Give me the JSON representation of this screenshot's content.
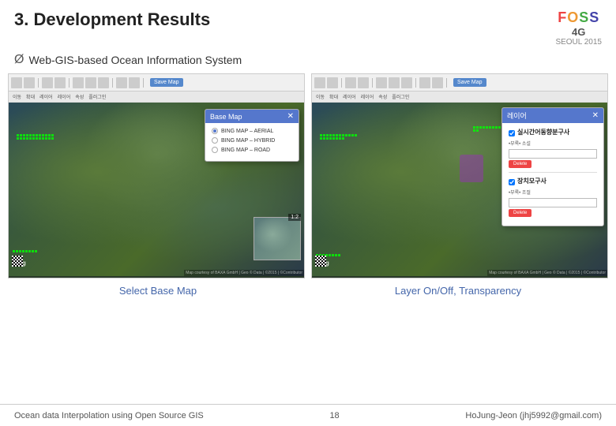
{
  "header": {
    "title": "3. Development Results",
    "logo": {
      "foss": "FOSS",
      "four_g": "4G",
      "seoul": "SEOUL 2015"
    }
  },
  "subtitle": {
    "prefix": "Ø",
    "text": "Web-GIS-based Ocean Information System"
  },
  "left_panel": {
    "toolbar": {
      "save_map": "Save Map"
    },
    "dialog": {
      "title": "Base Map",
      "options": [
        {
          "label": "BING MAP - AERIAL",
          "selected": true
        },
        {
          "label": "BING MAP - HYBRID",
          "selected": false
        },
        {
          "label": "BING MAP - ROAD",
          "selected": false
        }
      ]
    },
    "caption": "Select Base Map"
  },
  "right_panel": {
    "toolbar": {
      "save_map": "Save Map"
    },
    "dialog": {
      "title": "레이어",
      "sections": [
        {
          "title": "실시간어동향분구사",
          "sub": "•부록• 소설",
          "btn": "Delete"
        },
        {
          "title": "장치모구사",
          "sub": "•부록• 조절",
          "btn": "Delete"
        }
      ]
    },
    "caption": "Layer On/Off, Transparency"
  },
  "footer": {
    "left": "Ocean data Interpolation using Open Source GIS",
    "center": "18",
    "right": "HoJung-Jeon (jhj5992@gmail.com)"
  }
}
